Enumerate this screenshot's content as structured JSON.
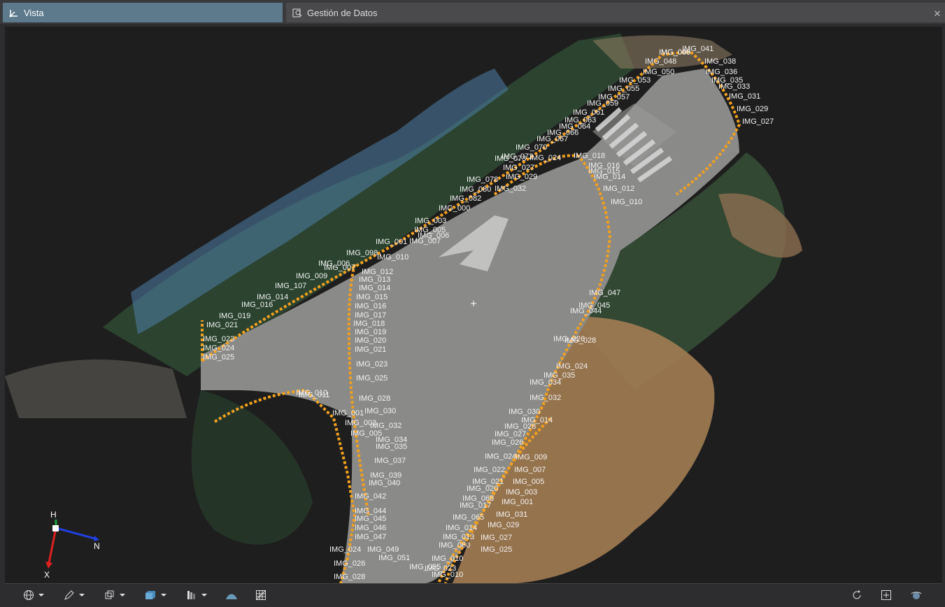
{
  "tabs": [
    {
      "label": "Vista",
      "icon": "axes-icon"
    },
    {
      "label": "Gestión de Datos",
      "icon": "data-management-icon"
    }
  ],
  "close_icon": "close-icon",
  "axes": {
    "up": "H",
    "north": "N",
    "x": "X"
  },
  "colors": {
    "track": "#f0a020",
    "active_tab": "#5c7a8c",
    "axis_x": "#e02020",
    "axis_n": "#2040e0",
    "axis_h": "#20a040"
  },
  "image_labels": [
    "IMG_046",
    "IMG_041",
    "IMG_048",
    "IMG_038",
    "IMG_050",
    "IMG_036",
    "IMG_035",
    "IMG_053",
    "IMG_055",
    "IMG_033",
    "IMG_031",
    "IMG_057",
    "IMG_059",
    "IMG_029",
    "IMG_027",
    "IMG_061",
    "IMG_063",
    "IMG_064",
    "IMG_066",
    "IMG_067",
    "IMG_070",
    "IMG_072",
    "IMG_018",
    "IMG_016",
    "IMG_015",
    "IMG_014",
    "IMG_073",
    "IMG_024",
    "IMG_027",
    "IMG_029",
    "IMG_078",
    "IMG_080",
    "IMG_032",
    "IMG_012",
    "IMG_082",
    "IMG_000",
    "IMG_010",
    "IMG_003",
    "IMG_005",
    "IMG_006",
    "IMG_007",
    "IMG_001",
    "IMG_010",
    "IMG_098",
    "IMG_006",
    "IMG_007",
    "IMG_012",
    "IMG_009",
    "IMG_013",
    "IMG_107",
    "IMG_014",
    "IMG_014",
    "IMG_015",
    "IMG_016",
    "IMG_016",
    "IMG_017",
    "IMG_019",
    "IMG_018",
    "IMG_021",
    "IMG_019",
    "IMG_020",
    "IMG_023",
    "IMG_021",
    "IMG_024",
    "IMG_025",
    "IMG_023",
    "IMG_025",
    "IMG_010",
    "IMG_011",
    "IMG_028",
    "IMG_030",
    "IMG_001",
    "IMG_003",
    "IMG_032",
    "IMG_005",
    "IMG_034",
    "IMG_035",
    "IMG_037",
    "IMG_039",
    "IMG_040",
    "IMG_042",
    "IMG_044",
    "IMG_045",
    "IMG_046",
    "IMG_047",
    "IMG_049",
    "IMG_051",
    "IMG_024",
    "IMG_026",
    "IMG_028",
    "IMG_055",
    "IMG_047",
    "IMG_045",
    "IMG_044",
    "IMG_028",
    "IMG_026",
    "IMG_024",
    "IMG_035",
    "IMG_034",
    "IMG_032",
    "IMG_030",
    "IMG_014",
    "IMG_028",
    "IMG_027",
    "IMG_026",
    "IMG_024",
    "IMG_009",
    "IMG_022",
    "IMG_007",
    "IMG_021",
    "IMG_005",
    "IMG_020",
    "IMG_003",
    "IMG_068",
    "IMG_001",
    "IMG_017",
    "IMG_031",
    "IMG_065",
    "IMG_029",
    "IMG_014",
    "IMG_013",
    "IMG_027",
    "IMG_060",
    "IMG_025",
    "IMG_010",
    "IMG_023",
    "IMG_010",
    "IMG_009"
  ],
  "toolbar": {
    "buttons": [
      {
        "name": "render-mode-button",
        "icon": "globe-icon",
        "dropdown": true
      },
      {
        "name": "measure-tool-button",
        "icon": "pen-icon",
        "dropdown": true
      },
      {
        "name": "view-cube-button",
        "icon": "wireframe-cube-icon",
        "dropdown": true
      },
      {
        "name": "solid-view-button",
        "icon": "solid-cube-icon",
        "dropdown": true
      },
      {
        "name": "color-ramp-button",
        "icon": "gradient-icon",
        "dropdown": true
      },
      {
        "name": "terrain-button",
        "icon": "mountain-icon",
        "dropdown": false
      },
      {
        "name": "grid-button",
        "icon": "grid-icon",
        "dropdown": false
      },
      {
        "name": "reset-rotation-button",
        "icon": "rotate-icon",
        "dropdown": false
      },
      {
        "name": "zoom-extents-button",
        "icon": "zoom-box-icon",
        "dropdown": false
      },
      {
        "name": "orbit-button",
        "icon": "orbit-icon",
        "dropdown": false
      }
    ]
  }
}
